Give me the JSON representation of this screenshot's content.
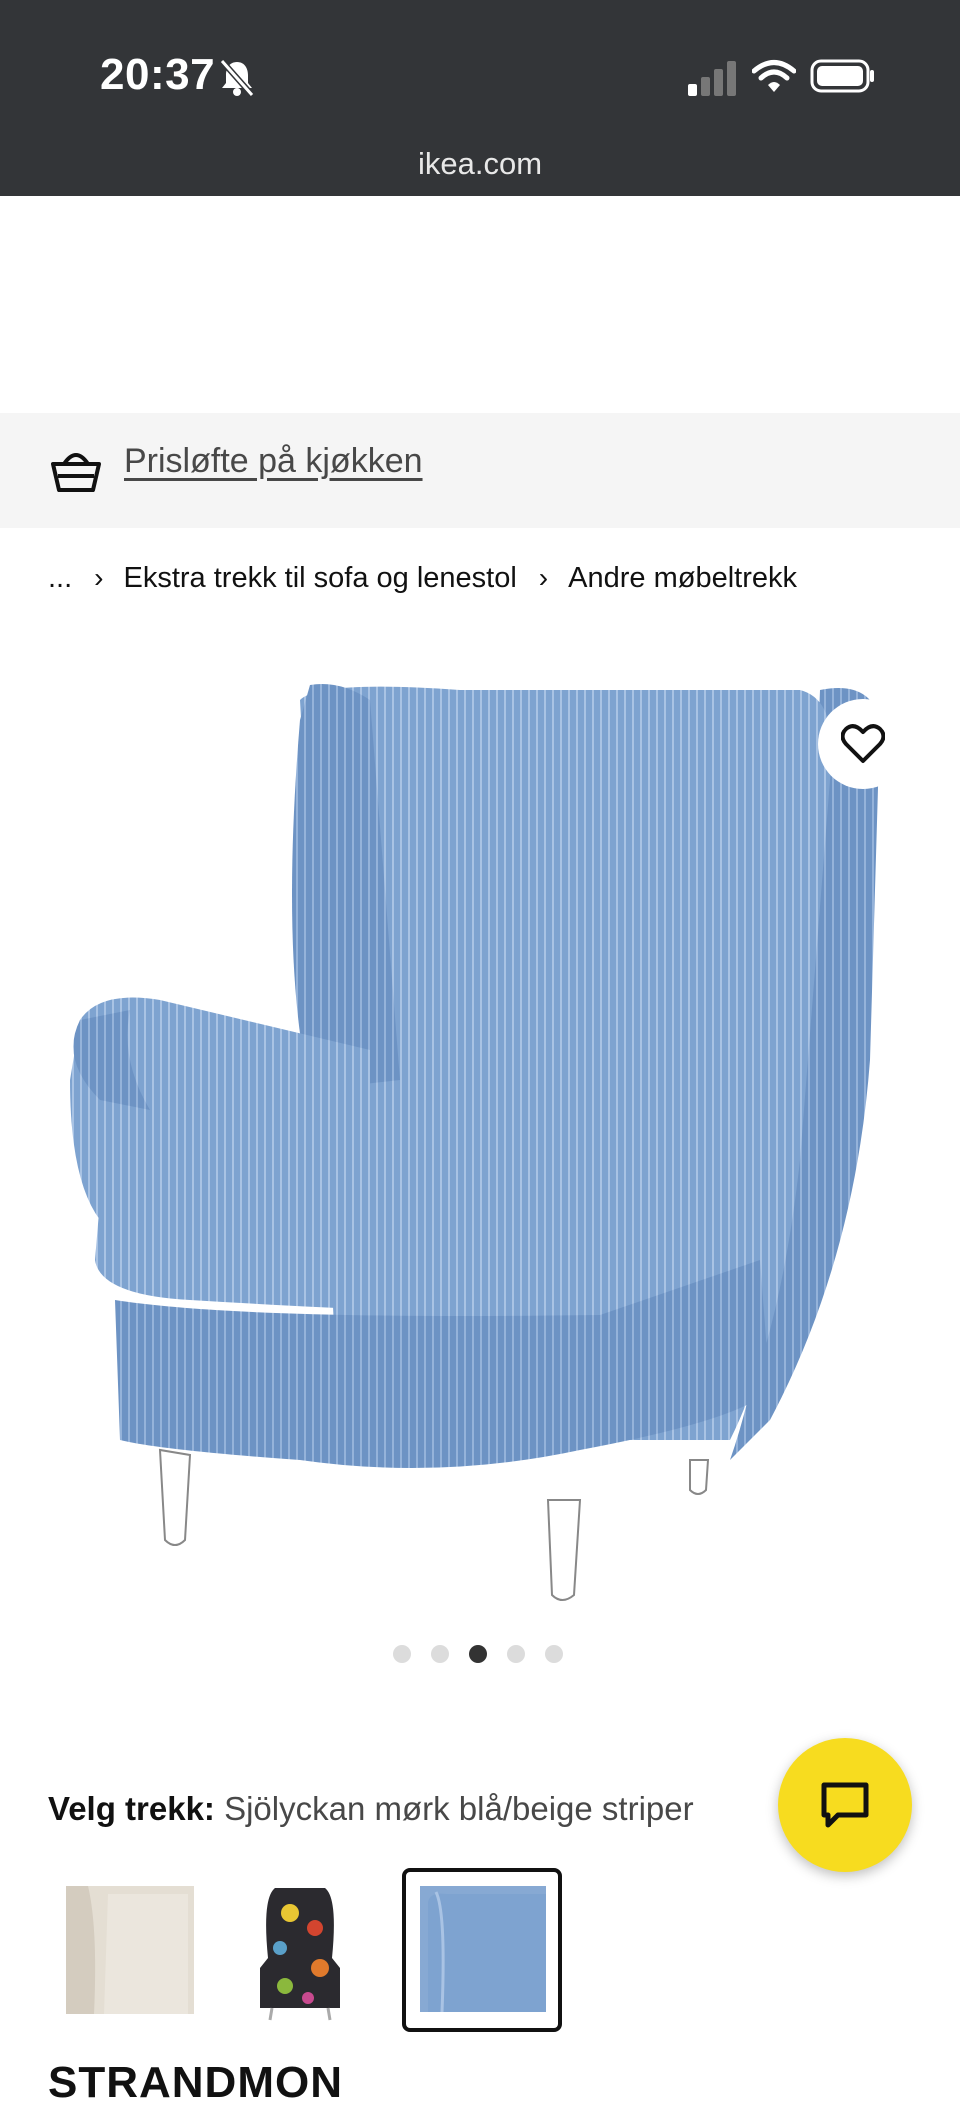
{
  "status_bar": {
    "time": "20:37",
    "url": "ikea.com"
  },
  "promo": {
    "link_label": "Prisløfte på kjøkken",
    "icon": "basket-icon"
  },
  "breadcrumb": {
    "ellipsis": "...",
    "items": [
      "Ekstra trekk til sofa og lenestol",
      "Andre møbeltrekk"
    ]
  },
  "gallery": {
    "dot_count": 5,
    "active_index": 2
  },
  "cover_select": {
    "label": "Velg trekk:",
    "value": "Sjölyckan mørk blå/beige striper"
  },
  "product": {
    "name": "STRANDMON"
  },
  "colors": {
    "status_bar_bg": "#333538",
    "chat_fab": "#f7dc1f",
    "chair_blue": "#7fa3cf"
  }
}
